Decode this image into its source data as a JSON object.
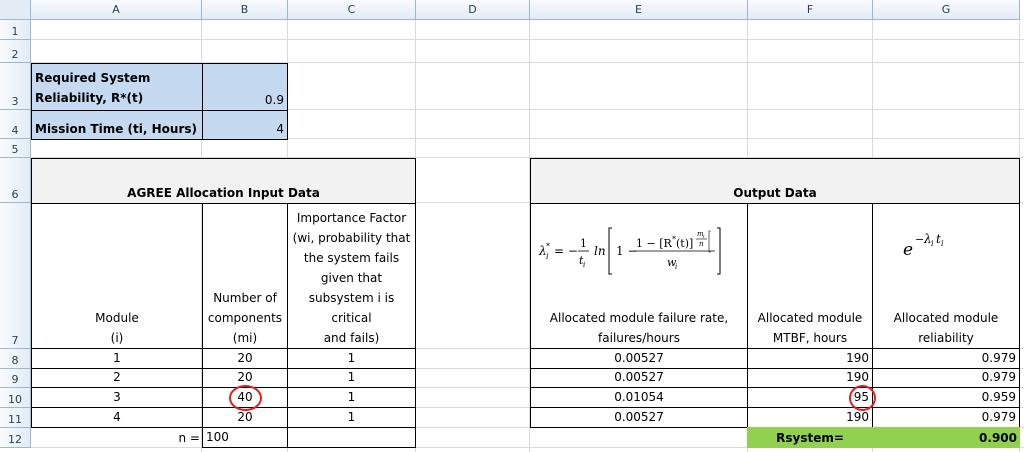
{
  "columns": [
    "A",
    "B",
    "C",
    "D",
    "E",
    "F",
    "G"
  ],
  "rows": [
    "1",
    "2",
    "3",
    "4",
    "5",
    "6",
    "7",
    "8",
    "9",
    "10",
    "11",
    "12"
  ],
  "colors": {
    "input_fill": "#c5d9f1",
    "header_fill": "#f2f2f2",
    "result_fill": "#92d050",
    "circle": "#e02020"
  },
  "inputs": {
    "required_label_line1": "Required System",
    "required_label_line2": "Reliability, R*(t)",
    "required_value": "0.9",
    "mission_label": "Mission Time (ti, Hours)",
    "mission_value": "4"
  },
  "input_table": {
    "title": "AGREE Allocation Input Data",
    "col_module": [
      "Module",
      "(i)"
    ],
    "col_components": [
      "Number of",
      "components",
      "(mi)"
    ],
    "col_importance": [
      "Importance Factor",
      "(wi, probability that",
      "the system fails",
      "given that",
      "subsystem i is",
      "critical",
      "and fails)"
    ],
    "rows": [
      {
        "module": "1",
        "components": "20",
        "importance": "1"
      },
      {
        "module": "2",
        "components": "20",
        "importance": "1"
      },
      {
        "module": "3",
        "components": "40",
        "importance": "1"
      },
      {
        "module": "4",
        "components": "20",
        "importance": "1"
      }
    ],
    "n_label": "n =",
    "n_value": "100"
  },
  "output_table": {
    "title": "Output Data",
    "formula_lambda": "λi* = −(1/ti) ln[1 − (1 − [R*(t)]^(mi/n)) / wi]",
    "formula_rel": "e^(−λi ti)",
    "col_rate": [
      "Allocated module failure rate,",
      "failures/hours"
    ],
    "col_mtbf": [
      "Allocated module",
      "MTBF, hours"
    ],
    "col_rel": [
      "Allocated module",
      "reliability"
    ],
    "rows": [
      {
        "rate": "0.00527",
        "mtbf": "190",
        "rel": "0.979"
      },
      {
        "rate": "0.00527",
        "mtbf": "190",
        "rel": "0.979"
      },
      {
        "rate": "0.01054",
        "mtbf": "95",
        "rel": "0.959"
      },
      {
        "rate": "0.00527",
        "mtbf": "190",
        "rel": "0.979"
      }
    ],
    "rsystem_label": "Rsystem=",
    "rsystem_value": "0.900"
  }
}
